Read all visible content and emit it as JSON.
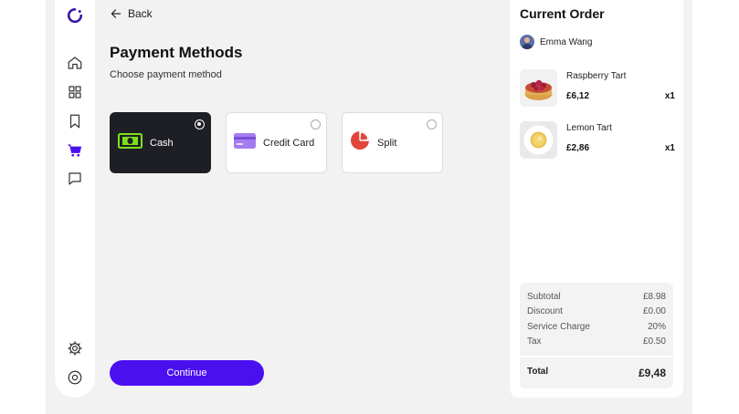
{
  "nav": {
    "back_label": "Back"
  },
  "sidebar": {
    "items": [
      {
        "name": "logo",
        "icon": "logo-icon"
      },
      {
        "name": "home",
        "icon": "home-icon"
      },
      {
        "name": "dashboard",
        "icon": "grid-icon"
      },
      {
        "name": "bookmarks",
        "icon": "bookmark-icon"
      },
      {
        "name": "cart",
        "icon": "cart-icon",
        "active": true
      },
      {
        "name": "messages",
        "icon": "chat-icon"
      },
      {
        "name": "settings",
        "icon": "gear-icon"
      },
      {
        "name": "power",
        "icon": "power-icon"
      }
    ]
  },
  "page": {
    "title": "Payment Methods",
    "subtitle": "Choose payment method"
  },
  "payment_methods": [
    {
      "label": "Cash",
      "icon": "cash-icon",
      "selected": true
    },
    {
      "label": "Credit Card",
      "icon": "credit-card-icon",
      "selected": false
    },
    {
      "label": "Split",
      "icon": "pie-chart-icon",
      "selected": false
    }
  ],
  "continue_label": "Continue",
  "order": {
    "title": "Current Order",
    "customer": "Emma Wang",
    "items": [
      {
        "name": "Raspberry Tart",
        "price": "£6,12",
        "qty": "x1"
      },
      {
        "name": "Lemon Tart",
        "price": "£2,86",
        "qty": "x1"
      }
    ],
    "summary": {
      "subtotal_label": "Subtotal",
      "subtotal": "£8.98",
      "discount_label": "Discount",
      "discount": "£0.00",
      "service_label": "Service Charge",
      "service": "20%",
      "tax_label": "Tax",
      "tax": "£0.50",
      "total_label": "Total",
      "total": "£9,48"
    }
  },
  "colors": {
    "accent": "#4b10f0",
    "selected_card": "#1e1f25",
    "cash_green": "#7ee01a",
    "card_purple": "#a57cf0",
    "split_red": "#e0463a",
    "background": "#f2f2f3"
  }
}
